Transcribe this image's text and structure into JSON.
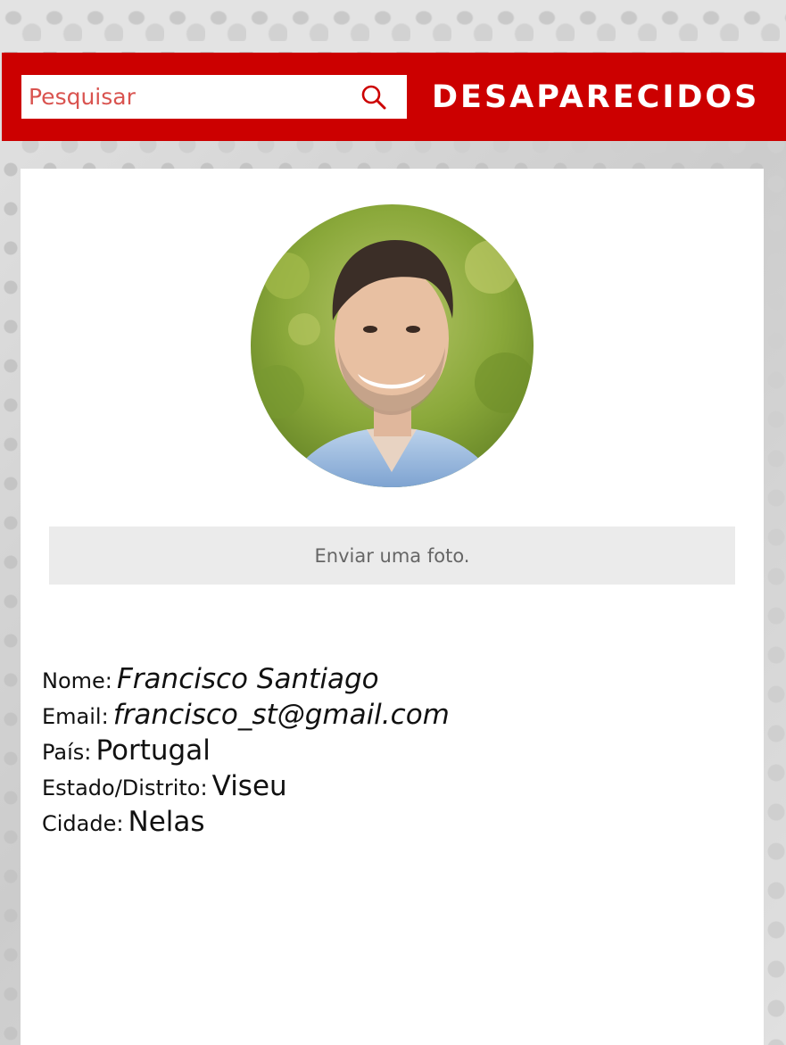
{
  "header": {
    "search": {
      "placeholder": "Pesquisar",
      "icon": "search-icon"
    },
    "brand": "DESAPARECIDOS",
    "color": "#cc0000"
  },
  "profile": {
    "photo_alt": "Francisco Santiago",
    "upload_label": "Enviar uma foto.",
    "fields": [
      {
        "label": "Nome:",
        "value": "Francisco Santiago"
      },
      {
        "label": "Email:",
        "value": "francisco_st@gmail.com"
      },
      {
        "label": "País:",
        "value": "Portugal"
      },
      {
        "label": "Estado/Distrito:",
        "value": "Viseu"
      },
      {
        "label": "Cidade:",
        "value": "Nelas"
      }
    ]
  }
}
